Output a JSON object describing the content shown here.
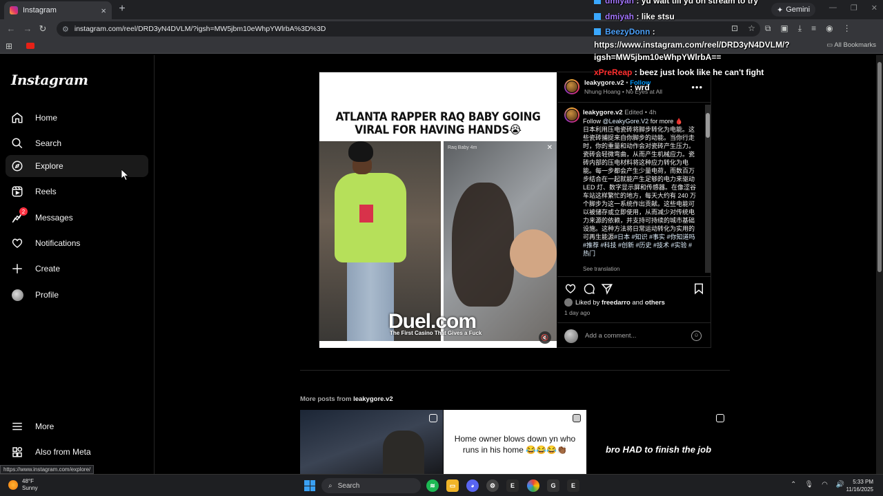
{
  "browser": {
    "tab_title": "Instagram",
    "tab_close": "×",
    "new_tab": "+",
    "gemini_label": "Gemini",
    "url": "instagram.com/reel/DRD3yN4DVLM/?igsh=MW5jbm10eWhpYWlrbA%3D%3D",
    "all_bookmarks": "All Bookmarks",
    "status_url": "https://www.instagram.com/explore/"
  },
  "sidebar": {
    "logo": "Instagram",
    "items": [
      {
        "label": "Home",
        "icon": "home-icon"
      },
      {
        "label": "Search",
        "icon": "search-icon"
      },
      {
        "label": "Explore",
        "icon": "compass-icon"
      },
      {
        "label": "Reels",
        "icon": "reels-icon"
      },
      {
        "label": "Messages",
        "icon": "messenger-icon",
        "badge": "2"
      },
      {
        "label": "Notifications",
        "icon": "heart-icon"
      },
      {
        "label": "Create",
        "icon": "plus-icon"
      },
      {
        "label": "Profile",
        "icon": "avatar"
      }
    ],
    "more": "More",
    "also_from_meta": "Also from Meta"
  },
  "post": {
    "headline": "ATLANTA RAPPER RAQ BABY GOING VIRAL FOR HAVING HANDS😭",
    "inner_video_user": "Raq Baby 4m",
    "watermark": "Duel.com",
    "watermark_sub": "The First Casino That Gives a Fuck",
    "username": "leakygore.v2",
    "dot": "•",
    "follow": "Follow",
    "audio": "Nhung Hoang • No Eyes at All",
    "caption_user": "leakygore.v2",
    "caption_meta": "Edited • 4h",
    "caption_follow_prefix": "Follow ",
    "caption_mention": "@LeakyGore.V2",
    "caption_follow_suffix": " for more 🩸",
    "caption_text": "日本利用压电瓷砖将脚步转化为电能。这些瓷砖捕捉来自你脚步的动能。当你行走时，你的重量和动作会对瓷砖产生压力。瓷砖会轻微弯曲，从而产生机械应力。瓷砖内部的压电材料将这种应力转化为电能。每一步都会产生少量电荷，而数百万步结合在一起就能产生足够的电力来驱动 LED 灯、数字显示屏和传感器。在像涩谷车站这样繁忙的地方，每天大约有 240 万个脚步为这一系统作出贡献。这些电能可以被储存或立即使用，从而减少对传统电力来源的依赖，并支持可持续的城市基础设施。这种方法将日常运动转化为实用的可再生能源",
    "caption_tags": "#日本 #知识 #事实 #你知道吗 #推荐 #科技 #创新 #历史 #技术 #实验 #热门",
    "see_translation": "See translation",
    "liked_by_prefix": "Liked by ",
    "liked_by_user": "freedarro",
    "liked_by_mid": " and ",
    "liked_by_others": "others",
    "time_ago": "1 day ago",
    "comment_placeholder": "Add a comment...",
    "more_posts_prefix": "More posts from ",
    "more_posts_user": "leakygore.v2"
  },
  "thumbs": [
    {
      "text": ""
    },
    {
      "text": "Home owner blows down yn who runs in his home 😂😂😂👏🏾"
    },
    {
      "text": "bro HAD to finish the job"
    }
  ],
  "chat": [
    {
      "name": "dmiyah",
      "sep": " : ",
      "text": "yu wait till yu on stream to try",
      "color": "purple"
    },
    {
      "name": "dmiyah",
      "sep": " : ",
      "text": "like stsu",
      "color": "purple"
    },
    {
      "name": "BeezyDonn",
      "sep": " :",
      "text": "",
      "color": "blue"
    },
    {
      "name": "",
      "sep": "",
      "text": "https://www.instagram.com/reel/DRD3yN4DVLM/?",
      "color": ""
    },
    {
      "name": "",
      "sep": "",
      "text": "igsh=MW5jbm10eWhpYWlrbA==",
      "color": ""
    },
    {
      "name": "xPreReap",
      "sep": " : ",
      "text": "beez just look like he can't fight",
      "color": "red"
    },
    {
      "name": "",
      "sep": "",
      "text": " : wrd",
      "color": ""
    }
  ],
  "taskbar": {
    "temp": "48°F",
    "condition": "Sunny",
    "search": "Search",
    "time": "5:33 PM",
    "date": "11/16/2025"
  }
}
